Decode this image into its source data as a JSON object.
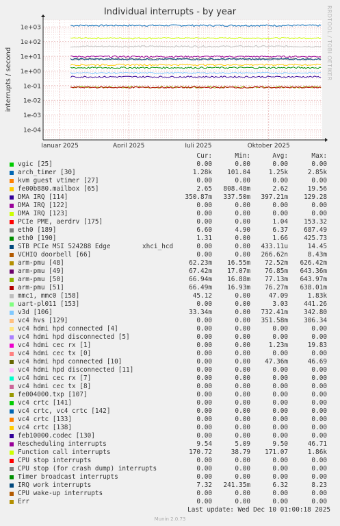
{
  "title": "Individual interrupts - by year",
  "side_credit": "RRDTOOL / TOBI OETIKER",
  "ylabel": "interrupts / second",
  "columns": {
    "cur": "Cur:",
    "min": "Min:",
    "avg": "Avg:",
    "max": "Max:"
  },
  "legend": [
    {
      "name": "vgic [25]",
      "color": "#00cc00",
      "cur": "0.00",
      "min": "0.00",
      "avg": "0.00",
      "max": "0.00"
    },
    {
      "name": "arch_timer [30]",
      "color": "#0066b3",
      "cur": "1.28k",
      "min": "101.04",
      "avg": "1.25k",
      "max": "2.85k"
    },
    {
      "name": "kvm guest vtimer [27]",
      "color": "#ff8000",
      "cur": "0.00",
      "min": "0.00",
      "avg": "0.00",
      "max": "0.00"
    },
    {
      "name": "fe00b880.mailbox [65]",
      "color": "#ffcc00",
      "cur": "2.65",
      "min": "808.48m",
      "avg": "2.62",
      "max": "19.56"
    },
    {
      "name": "DMA IRQ [114]",
      "color": "#330099",
      "cur": "350.87m",
      "min": "337.50m",
      "avg": "397.21m",
      "max": "129.28"
    },
    {
      "name": "DMA IRQ [122]",
      "color": "#990099",
      "cur": "0.00",
      "min": "0.00",
      "avg": "0.00",
      "max": "0.00"
    },
    {
      "name": "DMA IRQ [123]",
      "color": "#ccff00",
      "cur": "0.00",
      "min": "0.00",
      "avg": "0.00",
      "max": "0.00"
    },
    {
      "name": "PCIe PME, aerdrv [175]",
      "color": "#ff0000",
      "cur": "0.00",
      "min": "0.00",
      "avg": "1.04",
      "max": "153.32"
    },
    {
      "name": "eth0 [189]",
      "color": "#808080",
      "cur": "6.60",
      "min": "4.90",
      "avg": "6.37",
      "max": "687.49"
    },
    {
      "name": "eth0 [190]",
      "color": "#008f00",
      "cur": "1.31",
      "min": "0.00",
      "avg": "1.66",
      "max": "425.73"
    },
    {
      "name": "STB PCIe MSI 524288 Edge",
      "extra": "xhci_hcd",
      "color": "#00487d",
      "cur": "0.00",
      "min": "0.00",
      "avg": "433.11u",
      "max": "14.45"
    },
    {
      "name": "VCHIQ doorbell [66]",
      "color": "#b35a00",
      "cur": "0.00",
      "min": "0.00",
      "avg": "266.62n",
      "max": "8.43m"
    },
    {
      "name": "arm-pmu [48]",
      "color": "#b38f00",
      "cur": "62.23m",
      "min": "16.55m",
      "avg": "72.52m",
      "max": "626.42m"
    },
    {
      "name": "arm-pmu [49]",
      "color": "#6b006b",
      "cur": "67.42m",
      "min": "17.07m",
      "avg": "76.85m",
      "max": "643.36m"
    },
    {
      "name": "arm-pmu [50]",
      "color": "#8fb300",
      "cur": "66.94m",
      "min": "16.88m",
      "avg": "77.13m",
      "max": "643.97m"
    },
    {
      "name": "arm-pmu [51]",
      "color": "#b30000",
      "cur": "66.49m",
      "min": "16.93m",
      "avg": "76.27m",
      "max": "638.01m"
    },
    {
      "name": "mmc1, mmc0 [158]",
      "color": "#bebebe",
      "cur": "45.12",
      "min": "0.00",
      "avg": "47.09",
      "max": "1.83k"
    },
    {
      "name": "uart-pl011 [153]",
      "color": "#80ff80",
      "cur": "0.00",
      "min": "0.00",
      "avg": "3.03",
      "max": "441.26"
    },
    {
      "name": "v3d [106]",
      "color": "#80c9ff",
      "cur": "33.34m",
      "min": "0.00",
      "avg": "732.41m",
      "max": "342.80"
    },
    {
      "name": "vc4 hvs [129]",
      "color": "#ffc080",
      "cur": "0.00",
      "min": "0.00",
      "avg": "351.58m",
      "max": "306.34"
    },
    {
      "name": "vc4 hdmi hpd connected [4]",
      "color": "#ffe680",
      "cur": "0.00",
      "min": "0.00",
      "avg": "0.00",
      "max": "0.00"
    },
    {
      "name": "vc4 hdmi hpd disconnected [5]",
      "color": "#aa80ff",
      "cur": "0.00",
      "min": "0.00",
      "avg": "0.00",
      "max": "0.00"
    },
    {
      "name": "vc4 hdmi cec rx [1]",
      "color": "#ee00cc",
      "cur": "0.00",
      "min": "0.00",
      "avg": "1.23m",
      "max": "19.83"
    },
    {
      "name": "vc4 hdmi cec tx [0]",
      "color": "#ff8080",
      "cur": "0.00",
      "min": "0.00",
      "avg": "0.00",
      "max": "0.00"
    },
    {
      "name": "vc4 hdmi hpd connected [10]",
      "color": "#666600",
      "cur": "0.00",
      "min": "0.00",
      "avg": "47.36m",
      "max": "46.69"
    },
    {
      "name": "vc4 hdmi hpd disconnected [11]",
      "color": "#ffbfff",
      "cur": "0.00",
      "min": "0.00",
      "avg": "0.00",
      "max": "0.00"
    },
    {
      "name": "vc4 hdmi cec rx [7]",
      "color": "#00ffcc",
      "cur": "0.00",
      "min": "0.00",
      "avg": "0.00",
      "max": "0.00"
    },
    {
      "name": "vc4 hdmi cec tx [8]",
      "color": "#cc6699",
      "cur": "0.00",
      "min": "0.00",
      "avg": "0.00",
      "max": "0.00"
    },
    {
      "name": "fe004000.txp [107]",
      "color": "#999900",
      "cur": "0.00",
      "min": "0.00",
      "avg": "0.00",
      "max": "0.00"
    },
    {
      "name": "vc4 crtc [141]",
      "color": "#00cc00",
      "cur": "0.00",
      "min": "0.00",
      "avg": "0.00",
      "max": "0.00"
    },
    {
      "name": "vc4 crtc, vc4 crtc [142]",
      "color": "#0066b3",
      "cur": "0.00",
      "min": "0.00",
      "avg": "0.00",
      "max": "0.00"
    },
    {
      "name": "vc4 crtc [133]",
      "color": "#ff8000",
      "cur": "0.00",
      "min": "0.00",
      "avg": "0.00",
      "max": "0.00"
    },
    {
      "name": "vc4 crtc [138]",
      "color": "#ffcc00",
      "cur": "0.00",
      "min": "0.00",
      "avg": "0.00",
      "max": "0.00"
    },
    {
      "name": "feb10000.codec [130]",
      "color": "#330099",
      "cur": "0.00",
      "min": "0.00",
      "avg": "0.00",
      "max": "0.00"
    },
    {
      "name": "Rescheduling interrupts",
      "color": "#990099",
      "cur": "9.54",
      "min": "5.09",
      "avg": "9.50",
      "max": "46.71"
    },
    {
      "name": "Function call interrupts",
      "color": "#ccff00",
      "cur": "170.72",
      "min": "38.79",
      "avg": "171.07",
      "max": "1.86k"
    },
    {
      "name": "CPU stop interrupts",
      "color": "#ff0000",
      "cur": "0.00",
      "min": "0.00",
      "avg": "0.00",
      "max": "0.00"
    },
    {
      "name": "CPU stop (for crash dump) interrupts",
      "color": "#808080",
      "cur": "0.00",
      "min": "0.00",
      "avg": "0.00",
      "max": "0.00"
    },
    {
      "name": "Timer broadcast interrupts",
      "color": "#008f00",
      "cur": "0.00",
      "min": "0.00",
      "avg": "0.00",
      "max": "0.00"
    },
    {
      "name": "IRQ work interrupts",
      "color": "#00487d",
      "cur": "7.32",
      "min": "241.35m",
      "avg": "6.32",
      "max": "8.23"
    },
    {
      "name": "CPU wake-up interrupts",
      "color": "#b35a00",
      "cur": "0.00",
      "min": "0.00",
      "avg": "0.00",
      "max": "0.00"
    },
    {
      "name": "Err",
      "color": "#b38f00",
      "cur": "0.00",
      "min": "0.00",
      "avg": "0.00",
      "max": "0.00"
    }
  ],
  "last_update": "Last update: Wed Dec 10 01:00:18 2025",
  "version": "Munin 2.0.73",
  "chart_data": {
    "type": "line",
    "title": "Individual interrupts - by year",
    "ylabel": "interrupts / second",
    "yscale": "log",
    "ylim": [
      2e-05,
      3000
    ],
    "yticks": [
      "1e-04",
      "1e-03",
      "1e-02",
      "1e-01",
      "1e+00",
      "1e+01",
      "1e+02",
      "1e+03"
    ],
    "xlim": [
      "2024-12-10",
      "2025-12-10"
    ],
    "xticks": [
      {
        "label": "Januar 2025",
        "date": "2025-01-01"
      },
      {
        "label": "April 2025",
        "date": "2025-04-01"
      },
      {
        "label": "Juli 2025",
        "date": "2025-07-01"
      },
      {
        "label": "Oktober 2025",
        "date": "2025-10-01"
      }
    ],
    "grid": true,
    "data_start": "2025-01-15",
    "series": [
      {
        "name": "arch_timer [30]",
        "color": "#0066b3",
        "level": 1250
      },
      {
        "name": "Function call interrupts",
        "color": "#ccff00",
        "level": 171
      },
      {
        "name": "mmc1, mmc0 [158]",
        "color": "#bebebe",
        "level": 47
      },
      {
        "name": "Rescheduling interrupts",
        "color": "#990099",
        "level": 9.5
      },
      {
        "name": "eth0 [189]",
        "color": "#808080",
        "level": 6.37
      },
      {
        "name": "IRQ work interrupts",
        "color": "#00487d",
        "level": 6.32
      },
      {
        "name": "fe00b880.mailbox [65]",
        "color": "#ffcc00",
        "level": 2.62
      },
      {
        "name": "eth0 [190]",
        "color": "#008f00",
        "level": 1.66
      },
      {
        "name": "v3d [106]",
        "color": "#80c9ff",
        "level": 0.73
      },
      {
        "name": "DMA IRQ [114]",
        "color": "#330099",
        "level": 0.397
      },
      {
        "name": "arm-pmu [50]",
        "color": "#8fb300",
        "level": 0.077
      },
      {
        "name": "arm-pmu [51]",
        "color": "#b30000",
        "level": 0.076
      }
    ]
  }
}
